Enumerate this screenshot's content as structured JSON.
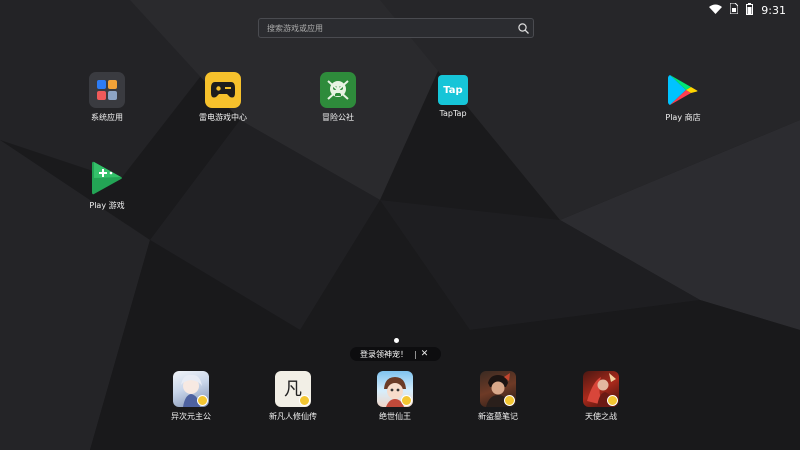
{
  "status_bar": {
    "time": "9:31",
    "icons": [
      "wifi-icon",
      "sim-icon",
      "battery-icon"
    ]
  },
  "search": {
    "placeholder": "搜索游戏或应用"
  },
  "home_apps": [
    {
      "label": "系统应用",
      "icon": "system-apps-folder-icon"
    },
    {
      "label": "雷电游戏中心",
      "icon": "leidian-game-center-icon"
    },
    {
      "label": "冒险公社",
      "icon": "adventure-society-icon"
    },
    {
      "label": "TapTap",
      "icon": "taptap-icon",
      "tile_text": "Tap"
    },
    {
      "label": "Play 商店",
      "icon": "play-store-icon"
    },
    {
      "label": "Play 游戏",
      "icon": "play-games-icon"
    }
  ],
  "page_indicator": {
    "pages": 1,
    "active": 1
  },
  "promo": {
    "text": "登录领神宠！",
    "close": "✕"
  },
  "dock_apps": [
    {
      "label": "异次元主公",
      "icon": "game-yiciyuan-icon"
    },
    {
      "label": "新凡人修仙传",
      "icon": "game-xinfanren-icon",
      "tile_text": "凡"
    },
    {
      "label": "绝世仙王",
      "icon": "game-jueshi-icon"
    },
    {
      "label": "新盗墓笔记",
      "icon": "game-daomu-icon"
    },
    {
      "label": "天使之战",
      "icon": "game-tianshi-icon"
    }
  ],
  "colors": {
    "background": "#1b1b1d",
    "leidian_yellow": "#f6c12c",
    "adventure_green": "#2e8b3b",
    "taptap_cyan": "#16c5d8"
  }
}
